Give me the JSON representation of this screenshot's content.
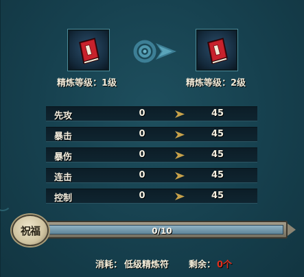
{
  "refine": {
    "current_level_label": "精炼等级：1级",
    "next_level_label": "精炼等级：2级",
    "item_icon": "red-book-icon",
    "transition_icon": "swirl-arrow-icon"
  },
  "stats": [
    {
      "name": "先攻",
      "from": "0",
      "to": "45"
    },
    {
      "name": "暴击",
      "from": "0",
      "to": "45"
    },
    {
      "name": "暴伤",
      "from": "0",
      "to": "45"
    },
    {
      "name": "连击",
      "from": "0",
      "to": "45"
    },
    {
      "name": "控制",
      "from": "0",
      "to": "45"
    }
  ],
  "blessing": {
    "badge_text": "祝福",
    "progress_text": "0/10",
    "progress_fraction": 0
  },
  "cost": {
    "label": "消耗：",
    "item": "低级精炼符",
    "remaining_label": "剩余：",
    "remaining_value": "0个"
  },
  "colors": {
    "accent_red": "#e0301e",
    "arrow_gold": "#c8a24a",
    "panel_bg": "#163a47"
  }
}
